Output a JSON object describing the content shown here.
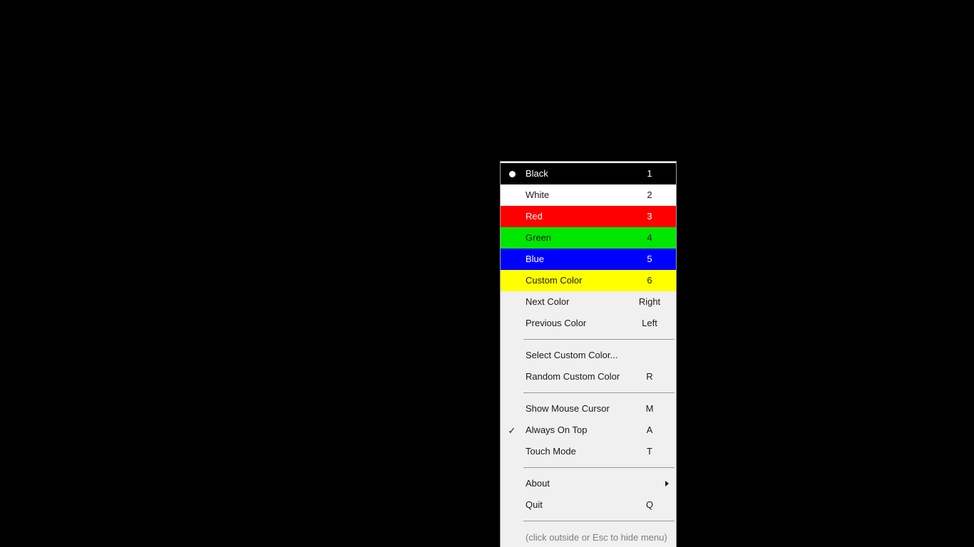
{
  "desktop": {
    "background_color": "#000000"
  },
  "menu": {
    "background_color": "#f0f0f0",
    "border_color": "#9a9a9a",
    "text_color": "#1a1a1a",
    "hint": "(click outside or Esc to hide menu)",
    "hint_color": "#7d7d7d",
    "color_items": [
      {
        "label": "Black",
        "shortcut": "1",
        "bg": "#000000",
        "fg": "#ffffff",
        "selected": true,
        "marker": "radio-dot"
      },
      {
        "label": "White",
        "shortcut": "2",
        "bg": "#ffffff",
        "fg": "#1a1a1a",
        "selected": false,
        "marker": ""
      },
      {
        "label": "Red",
        "shortcut": "3",
        "bg": "#ff0000",
        "fg": "#ffffff",
        "selected": false,
        "marker": ""
      },
      {
        "label": "Green",
        "shortcut": "4",
        "bg": "#00e600",
        "fg": "#1a1a1a",
        "selected": false,
        "marker": ""
      },
      {
        "label": "Blue",
        "shortcut": "5",
        "bg": "#0000ff",
        "fg": "#ffffff",
        "selected": false,
        "marker": ""
      },
      {
        "label": "Custom Color",
        "shortcut": "6",
        "bg": "#ffff00",
        "fg": "#1a1a1a",
        "selected": false,
        "marker": ""
      }
    ],
    "navigation_items": [
      {
        "label": "Next Color",
        "shortcut": "Right"
      },
      {
        "label": "Previous Color",
        "shortcut": "Left"
      }
    ],
    "custom_items": [
      {
        "label": "Select Custom Color...",
        "shortcut": ""
      },
      {
        "label": "Random Custom Color",
        "shortcut": "R"
      }
    ],
    "toggle_items": [
      {
        "label": "Show Mouse Cursor",
        "shortcut": "M",
        "checked": false
      },
      {
        "label": "Always On Top",
        "shortcut": "A",
        "checked": true
      },
      {
        "label": "Touch Mode",
        "shortcut": "T",
        "checked": false
      }
    ],
    "app_items": [
      {
        "label": "About",
        "shortcut": "",
        "submenu": true
      },
      {
        "label": "Quit",
        "shortcut": "Q",
        "submenu": false
      }
    ]
  }
}
